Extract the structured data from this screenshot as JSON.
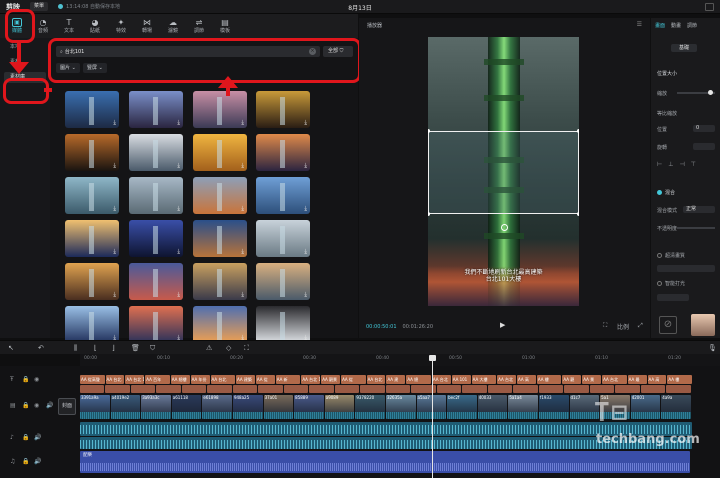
{
  "titlebar": {
    "app_name": "剪映",
    "menu_label": "菜單",
    "autosave": "13:14:08 自動保存本地",
    "project_title": "8月13日"
  },
  "toolbar": {
    "tools": [
      {
        "label": "媒體",
        "icon": "▣",
        "active": true
      },
      {
        "label": "音頻",
        "icon": "◔"
      },
      {
        "label": "文本",
        "icon": "T"
      },
      {
        "label": "貼紙",
        "icon": "◕"
      },
      {
        "label": "特效",
        "icon": "✦"
      },
      {
        "label": "轉場",
        "icon": "⋈"
      },
      {
        "label": "濾鏡",
        "icon": "☁"
      },
      {
        "label": "調節",
        "icon": "⇌"
      },
      {
        "label": "模板",
        "icon": "▤"
      }
    ]
  },
  "left_nav": {
    "items": [
      "本地",
      "素材",
      "素材庫"
    ]
  },
  "media": {
    "search_value": "台北101",
    "filter_all": "全部",
    "chip_type": "圖片",
    "chip_orient": "豎屏",
    "thumbs": [
      {
        "c1": "#3a6fb0",
        "c2": "#1d2a44"
      },
      {
        "c1": "#7a8fc9",
        "c2": "#2a2540"
      },
      {
        "c1": "#c88fa5",
        "c2": "#3b3a55"
      },
      {
        "c1": "#c99a3a",
        "c2": "#2a1d14"
      },
      {
        "c1": "#b86a2a",
        "c2": "#1a1410"
      },
      {
        "c1": "#d9dde2",
        "c2": "#4a5a6a"
      },
      {
        "c1": "#f0b540",
        "c2": "#a3601c"
      },
      {
        "c1": "#e08a4a",
        "c2": "#2c2440"
      },
      {
        "c1": "#8fb7c8",
        "c2": "#3b5a6a"
      },
      {
        "c1": "#a7b8c6",
        "c2": "#5a6a74"
      },
      {
        "c1": "#8d9fb8",
        "c2": "#c9743a"
      },
      {
        "c1": "#6f9fd6",
        "c2": "#2d4f7a"
      },
      {
        "c1": "#f0c070",
        "c2": "#1c2a5a"
      },
      {
        "c1": "#3a4fa8",
        "c2": "#0e1430"
      },
      {
        "c1": "#2a4f8a",
        "c2": "#b8733a"
      },
      {
        "c1": "#c8d2da",
        "c2": "#6a7a84"
      },
      {
        "c1": "#e0a350",
        "c2": "#4a2e20"
      },
      {
        "c1": "#4a5a9a",
        "c2": "#c85a4a"
      },
      {
        "c1": "#c9a060",
        "c2": "#3a3a4a"
      },
      {
        "c1": "#d9b080",
        "c2": "#4a5a6a"
      },
      {
        "c1": "#9ac0e6",
        "c2": "#1f2f5a"
      },
      {
        "c1": "#e07050",
        "c2": "#28305a"
      },
      {
        "c1": "#4f6fb0",
        "c2": "#f0a050"
      },
      {
        "c1": "#2a2a2e",
        "c2": "#dfe2e6"
      }
    ]
  },
  "player": {
    "title": "播放器",
    "current_time": "00:00:50:01",
    "total_time": "00:01:26:20",
    "ratio_label": "比例",
    "subtitle": "我們不斷地刷新台北最高建築\n台北101大樓"
  },
  "inspector": {
    "tabs": [
      "畫面",
      "動畫",
      "調節"
    ],
    "sub_tab": "基礎",
    "position_size": "位置大小",
    "scale": "縮放",
    "uniform_scale": "等比縮放",
    "position": "位置",
    "position_value": "0",
    "rotate": "旋轉",
    "blend": "混合",
    "blend_mode": "混合模式",
    "blend_mode_value": "正常",
    "opacity": "不透明度",
    "super_res": "超清畫質",
    "smart_ai": "智能打光"
  },
  "timeline": {
    "ticks": [
      "00:00",
      "00:10",
      "00:20",
      "00:30",
      "00:40",
      "00:50",
      "01:00",
      "01:10",
      "01:20"
    ],
    "cover_label": "封面",
    "music_label": "配樂",
    "sub_clips": [
      "AA 從高聳",
      "AA 台北",
      "AA 台北 101",
      "AA 百年",
      "AA 總樓",
      "AA 年份",
      "AA 台北",
      "AA 建築",
      "AA 從",
      "AA 新",
      "AA 台北 101",
      "AA 觀景",
      "AA 從",
      "AA 台北",
      "AA 建",
      "AA 總",
      "AA 台北",
      "AA 101",
      "AA 大樓",
      "AA 台北",
      "AA 高",
      "AA 樓",
      "AA 觀",
      "AA 景",
      "AA 台北",
      "AA 最",
      "AA 高",
      "AA 樓"
    ],
    "video_clips": [
      {
        "label": "3391a9a",
        "c": "#4a6a9a"
      },
      {
        "label": "a4019e2",
        "c": "#3a5a7a"
      },
      {
        "label": "3a93a3c",
        "c": "#6a7a9a"
      },
      {
        "label": "a61118",
        "c": "#2a3a5a"
      },
      {
        "label": "e61898",
        "c": "#5a6a8a"
      },
      {
        "label": "948a25",
        "c": "#3a4a7a"
      },
      {
        "label": "37a01",
        "c": "#7a6a5a"
      },
      {
        "label": "85889",
        "c": "#4a5a8a"
      },
      {
        "label": "a9089",
        "c": "#9a8a6a"
      },
      {
        "label": "9378220",
        "c": "#3a5a6a"
      },
      {
        "label": "32635a",
        "c": "#6a8aa0"
      },
      {
        "label": "a5aa7",
        "c": "#5a7a9a"
      },
      {
        "label": "bec2f",
        "c": "#3a6a8a"
      },
      {
        "label": "40033",
        "c": "#4a5a6a"
      },
      {
        "label": "5a1a4",
        "c": "#7a8a9a"
      },
      {
        "label": "f1933",
        "c": "#2a4a6a"
      },
      {
        "label": "d1c7",
        "c": "#5a6a7a"
      },
      {
        "label": "5a1",
        "c": "#8a7a6a"
      },
      {
        "label": "42001",
        "c": "#4a6a8a"
      },
      {
        "label": "4a9a",
        "c": "#3a4a5a"
      }
    ]
  },
  "watermark": {
    "logo": "T⊟",
    "text": "techbang.com"
  }
}
